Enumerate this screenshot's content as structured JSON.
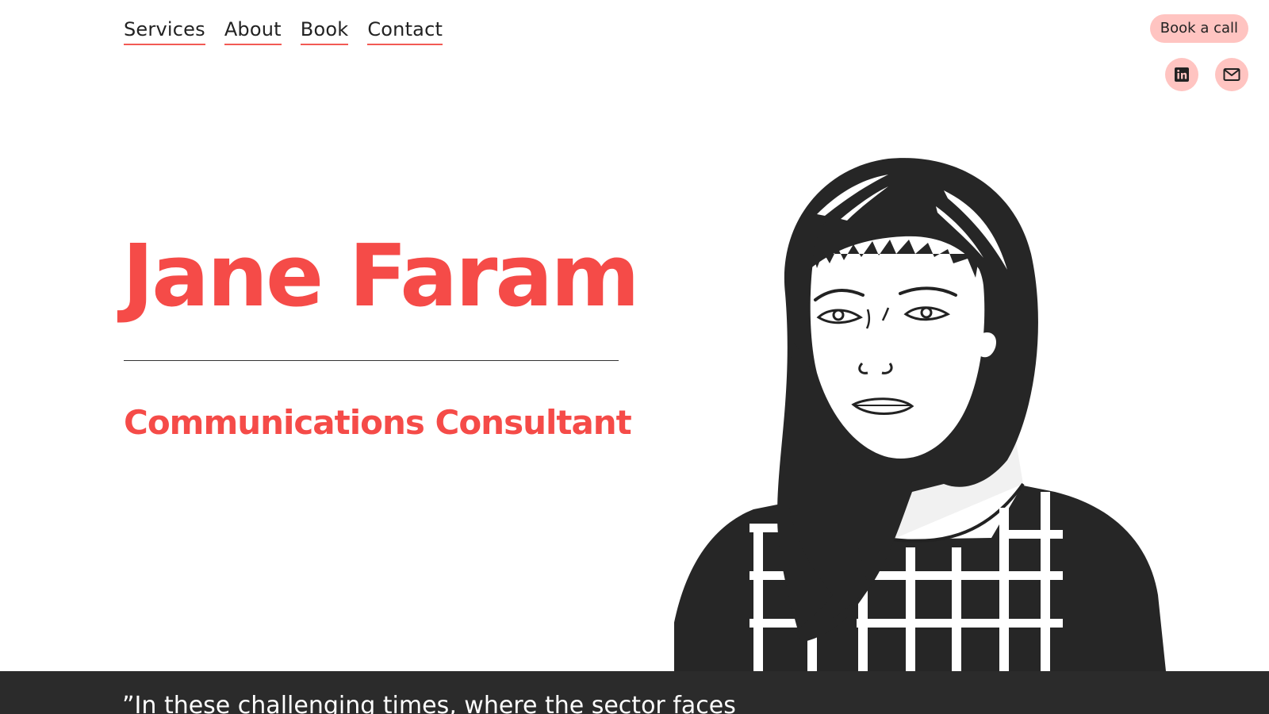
{
  "nav": {
    "items": [
      "Services",
      "About",
      "Book",
      "Contact"
    ]
  },
  "cta": {
    "label": "Book a call"
  },
  "social": {
    "icons": [
      "linkedin-icon",
      "mail-icon"
    ]
  },
  "hero": {
    "name": "Jane Faram",
    "role": "Communications Consultant"
  },
  "quote": {
    "text": "”In these challenging times, where the sector faces"
  },
  "colors": {
    "accent": "#f54b48",
    "pill": "#ffc4c1",
    "dark": "#2b2b2b"
  }
}
